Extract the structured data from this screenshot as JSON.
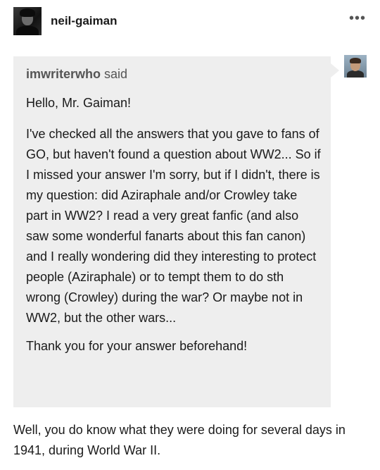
{
  "post": {
    "author": "neil-gaiman",
    "more_icon": "more-horizontal-icon",
    "more_glyph": "•••"
  },
  "ask": {
    "asker": "imwriterwho",
    "said": "said",
    "greeting": "Hello, Mr. Gaiman!",
    "question": "I've checked all the answers that you gave to fans of GO, but haven't found a question about WW2... So if I missed your answer I'm sorry, but if I didn't, there is my question: did Aziraphale and/or Crowley take part in WW2? I read a very great fanfic (and also saw some wonderful fanarts about this fan canon) and I really wondering did they interesting to protect people (Aziraphale) or to tempt them to do sth wrong (Crowley) during the war? Or maybe not in WW2, but the other wars...",
    "thanks": "Thank you for your answer beforehand!"
  },
  "answer": {
    "text": "Well, you do know what they were doing for several days in 1941, during World War II."
  },
  "colors": {
    "ask_background": "#eeeeee",
    "text": "#1a1a1a",
    "muted": "#555555"
  }
}
